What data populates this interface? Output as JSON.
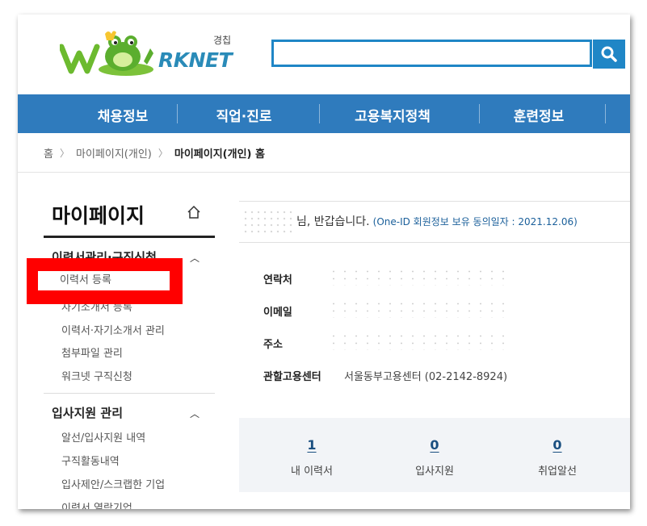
{
  "header": {
    "logo_text": "RKNET",
    "logo_note": "경칩",
    "search": {
      "placeholder": ""
    }
  },
  "nav": {
    "items": [
      {
        "label": "채용정보"
      },
      {
        "label": "직업·진로"
      },
      {
        "label": "고용복지정책"
      },
      {
        "label": "훈련정보"
      }
    ]
  },
  "breadcrumb": {
    "items": [
      "홈",
      "마이페이지(개인)",
      "마이페이지(개인) 홈"
    ]
  },
  "sidebar": {
    "title": "마이페이지",
    "sections": [
      {
        "title": "이력서관리·구직신청",
        "items": [
          "이력서 등록",
          "자기소개서 등록",
          "이력서·자기소개서 관리",
          "첨부파일 관리",
          "워크넷 구직신청"
        ]
      },
      {
        "title": "입사지원 관리",
        "items": [
          "알선/입사지원 내역",
          "구직활동내역",
          "입사제안/스크랩한 기업",
          "이력서 열람기업"
        ]
      }
    ]
  },
  "main": {
    "greeting": "님, 반갑습니다.",
    "consent": "(One-ID 회원정보 보유 동의일자 : 2021.12.06)",
    "info": {
      "contact_label": "연락처",
      "email_label": "이메일",
      "address_label": "주소",
      "center_label": "관할고용센터",
      "center_value": "서울동부고용센터 (02-2142-8924)"
    },
    "stats": [
      {
        "count": "1",
        "label": "내 이력서"
      },
      {
        "count": "0",
        "label": "입사지원"
      },
      {
        "count": "0",
        "label": "취업알선"
      }
    ]
  },
  "colors": {
    "nav_bg": "#2f7bbd",
    "search_border": "#1f86c6",
    "highlight": "#ff0000",
    "stat_number": "#1a4f80"
  }
}
